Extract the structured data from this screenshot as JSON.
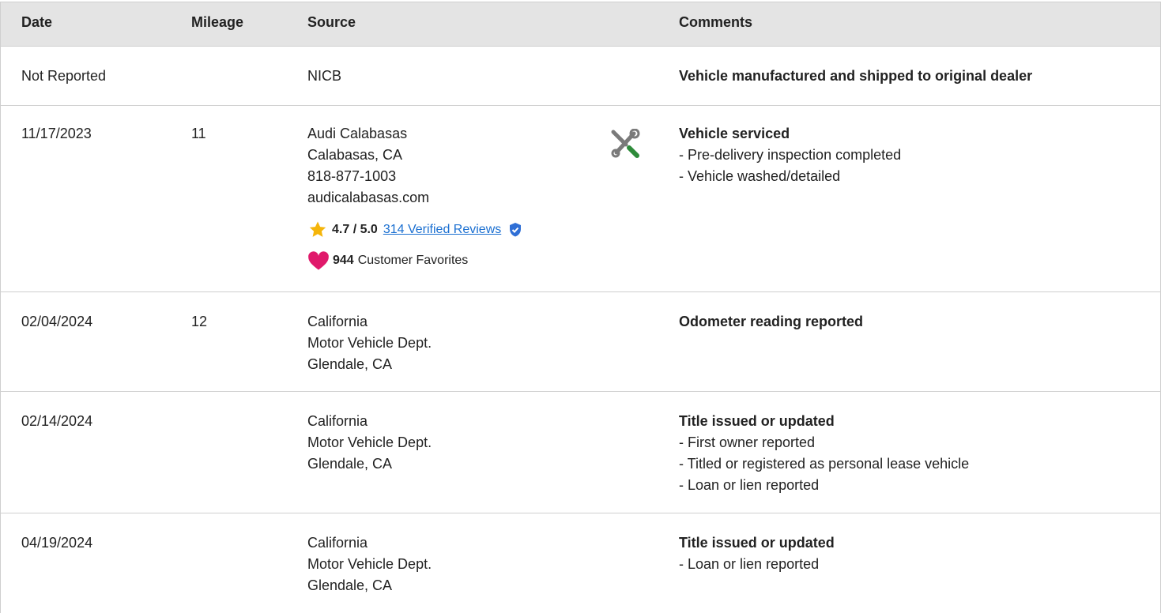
{
  "header": {
    "date": "Date",
    "mileage": "Mileage",
    "source": "Source",
    "comments": "Comments"
  },
  "rows": [
    {
      "date": "Not Reported",
      "mileage": "",
      "source": [
        "NICB"
      ],
      "comment_title": "Vehicle manufactured and shipped to original dealer",
      "comment_items": []
    },
    {
      "date": "11/17/2023",
      "mileage": "11",
      "source": [
        "Audi Calabasas",
        "Calabasas, CA",
        "818-877-1003",
        "audicalabasas.com"
      ],
      "rating": "4.7 / 5.0",
      "reviews_link": "314 Verified Reviews",
      "favorites_count": "944",
      "favorites_label": "Customer Favorites",
      "service_icon": "wrench-screwdriver-icon",
      "comment_title": "Vehicle serviced",
      "comment_items": [
        "- Pre-delivery inspection completed",
        "- Vehicle washed/detailed"
      ]
    },
    {
      "date": "02/04/2024",
      "mileage": "12",
      "source": [
        "California",
        "Motor Vehicle Dept.",
        "Glendale, CA"
      ],
      "comment_title": "Odometer reading reported",
      "comment_items": []
    },
    {
      "date": "02/14/2024",
      "mileage": "",
      "source": [
        "California",
        "Motor Vehicle Dept.",
        "Glendale, CA"
      ],
      "comment_title": "Title issued or updated",
      "comment_items": [
        "- First owner reported",
        "- Titled or registered as personal lease vehicle",
        "- Loan or lien reported"
      ]
    },
    {
      "date": "04/19/2024",
      "mileage": "",
      "source": [
        "California",
        "Motor Vehicle Dept.",
        "Glendale, CA"
      ],
      "comment_title": "Title issued or updated",
      "comment_items": [
        "- Loan or lien reported"
      ]
    }
  ],
  "colors": {
    "header_bg": "#e4e4e4",
    "link": "#1a6fd1",
    "star": "#f5b50a",
    "heart": "#e0196b",
    "verified": "#2f6fd6",
    "wrench": "#7a7a7a",
    "screwdriver": "#2e8b3a"
  }
}
